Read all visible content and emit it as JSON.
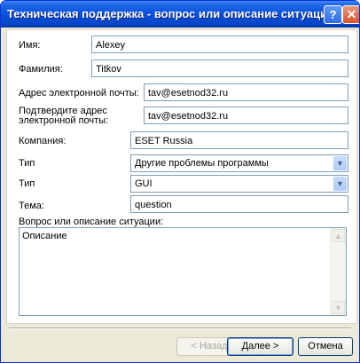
{
  "window": {
    "title": "Техническая поддержка - вопрос или описание ситуации",
    "help_glyph": "?",
    "close_glyph": "✕"
  },
  "form": {
    "first_name": {
      "label": "Имя:",
      "value": "Alexey"
    },
    "last_name": {
      "label": "Фамилия:",
      "value": "Titkov"
    },
    "email": {
      "label": "Адрес электронной почты:",
      "value": "tav@esetnod32.ru"
    },
    "email_confirm": {
      "label_line1": "Подтвердите адрес",
      "label_line2": "электронной почты:",
      "value": "tav@esetnod32.ru"
    },
    "company": {
      "label": "Компания:",
      "value": "ESET Russia"
    },
    "type1": {
      "label": "Тип",
      "value": "Другие проблемы программы"
    },
    "type2": {
      "label": "Тип",
      "value": "GUI"
    },
    "subject": {
      "label": "Тема:",
      "value": "question"
    },
    "description": {
      "label": "Вопрос или описание ситуации:",
      "value": "Описание"
    }
  },
  "buttons": {
    "back": "< Назад",
    "next": "Далее >",
    "cancel": "Отмена"
  },
  "icons": {
    "dropdown": "chevron-down-icon",
    "scroll_up": "scroll-up-icon",
    "scroll_down": "scroll-down-icon"
  },
  "colors": {
    "titlebar": "#0a54df",
    "dialog_bg": "#ece9d8",
    "field_border": "#7f9db9"
  }
}
